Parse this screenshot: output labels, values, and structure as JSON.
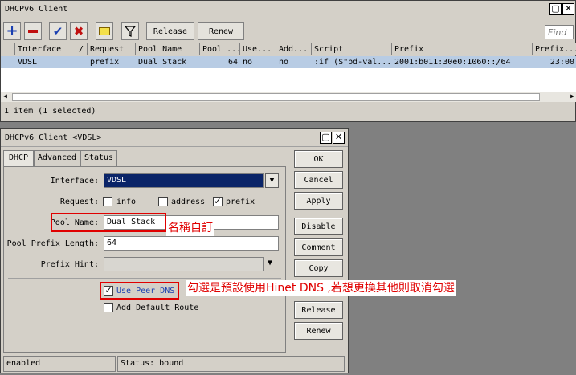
{
  "main_window": {
    "title": "DHCPv6 Client",
    "toolbar": {
      "release_label": "Release",
      "renew_label": "Renew",
      "find_placeholder": "Find"
    },
    "columns": [
      "Interface",
      "Request",
      "Pool Name",
      "Pool ...",
      "Use...",
      "Add...",
      "Script",
      "Prefix",
      "Prefix..."
    ],
    "row": {
      "interface": "VDSL",
      "request": "prefix",
      "pool_name": "Dual Stack",
      "pool_len": "64",
      "use_peer": "no",
      "add_route": "no",
      "script": ":if ($\"pd-val...",
      "prefix": "2001:b011:30e0:1060::/64",
      "prefix_exp": "23:00"
    },
    "status": "1 item (1 selected)"
  },
  "dialog": {
    "title": "DHCPv6 Client <VDSL>",
    "tabs": [
      "DHCP",
      "Advanced",
      "Status"
    ],
    "interface_label": "Interface:",
    "interface_value": "VDSL",
    "request_label": "Request:",
    "request_options": {
      "info": "info",
      "address": "address",
      "prefix": "prefix"
    },
    "pool_name_label": "Pool Name:",
    "pool_name_value": "Dual Stack",
    "pool_prefix_length_label": "Pool Prefix Length:",
    "pool_prefix_length_value": "64",
    "prefix_hint_label": "Prefix Hint:",
    "use_peer_dns_label": "Use Peer DNS",
    "add_default_route_label": "Add Default Route",
    "buttons": {
      "ok": "OK",
      "cancel": "Cancel",
      "apply": "Apply",
      "disable": "Disable",
      "comment": "Comment",
      "copy": "Copy",
      "release": "Release",
      "renew": "Renew"
    },
    "status_left": "enabled",
    "status_right": "Status: bound"
  },
  "annotations": {
    "pool_name_note": "名稱自訂",
    "dns_note": "勾選是預設使用Hinet DNS ,若想更換其他則取消勾選"
  },
  "colors": {
    "selection": "#b8cce4",
    "annotation": "#e00000",
    "interface_field": "#0a2468"
  }
}
